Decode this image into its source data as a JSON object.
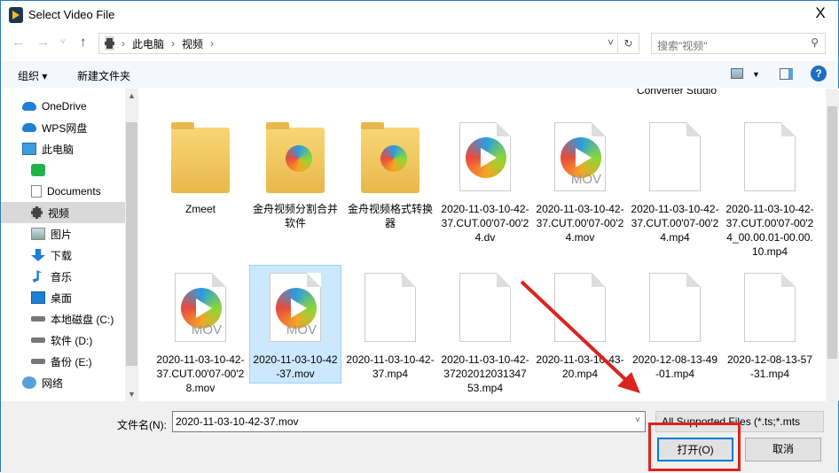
{
  "window": {
    "title": "Select Video File",
    "close": "X"
  },
  "nav": {
    "back": "←",
    "forward": "→",
    "recent": "˅",
    "up": "↑",
    "breadcrumb": [
      "此电脑",
      "视频"
    ],
    "search_placeholder": "搜索\"视频\""
  },
  "toolbar": {
    "organize": "组织 ▾",
    "new_folder": "新建文件夹",
    "help": "?"
  },
  "sidebar": {
    "items": [
      {
        "label": "OneDrive",
        "icon": "cloud-icon"
      },
      {
        "label": "WPS网盘",
        "icon": "cloud-icon"
      },
      {
        "label": "此电脑",
        "icon": "computer-icon"
      },
      {
        "label": "",
        "icon": "app-icon"
      },
      {
        "label": "Documents",
        "icon": "document-icon"
      },
      {
        "label": "视频",
        "icon": "video-folder-icon"
      },
      {
        "label": "图片",
        "icon": "picture-icon"
      },
      {
        "label": "下载",
        "icon": "download-icon"
      },
      {
        "label": "音乐",
        "icon": "music-icon"
      },
      {
        "label": "桌面",
        "icon": "desktop-icon"
      },
      {
        "label": "本地磁盘 (C:)",
        "icon": "drive-icon"
      },
      {
        "label": "软件 (D:)",
        "icon": "drive-icon"
      },
      {
        "label": "备份 (E:)",
        "icon": "drive-icon"
      },
      {
        "label": "网络",
        "icon": "network-icon"
      }
    ]
  },
  "files": [
    {
      "name": "Converter Studio",
      "type": "partial"
    },
    {
      "name": "Zmeet",
      "type": "folder"
    },
    {
      "name": "金舟视频分割合并软件",
      "type": "folder-app"
    },
    {
      "name": "金舟视频格式转换器",
      "type": "folder-app"
    },
    {
      "name": "2020-11-03-10-42-37.CUT.00'07-00'24.dv",
      "type": "video"
    },
    {
      "name": "2020-11-03-10-42-37.CUT.00'07-00'24.mov",
      "type": "mov"
    },
    {
      "name": "2020-11-03-10-42-37.CUT.00'07-00'24.mp4",
      "type": "blank"
    },
    {
      "name": "2020-11-03-10-42-37.CUT.00'07-00'24_00.00.01-00.00.10.mp4",
      "type": "blank"
    },
    {
      "name": "2020-11-03-10-42-37.CUT.00'07-00'28.mov",
      "type": "mov"
    },
    {
      "name": "2020-11-03-10-42-37.mov",
      "type": "mov",
      "selected": true
    },
    {
      "name": "2020-11-03-10-42-37.mp4",
      "type": "blank"
    },
    {
      "name": "2020-11-03-10-42-3720201203134753.mp4",
      "type": "blank"
    },
    {
      "name": "2020-11-03-10-43-20.mp4",
      "type": "blank"
    },
    {
      "name": "2020-12-08-13-49-01.mp4",
      "type": "blank"
    },
    {
      "name": "2020-12-08-13-57-31.mp4",
      "type": "blank"
    }
  ],
  "footer": {
    "filename_label": "文件名(N):",
    "filename_value": "2020-11-03-10-42-37.mov",
    "filter": "All Supported Files (*.ts;*.mts",
    "open": "打开(O)",
    "cancel": "取消"
  },
  "colors": {
    "accent": "#0078d7",
    "highlight": "#e0211d",
    "selected": "#cce8ff"
  }
}
